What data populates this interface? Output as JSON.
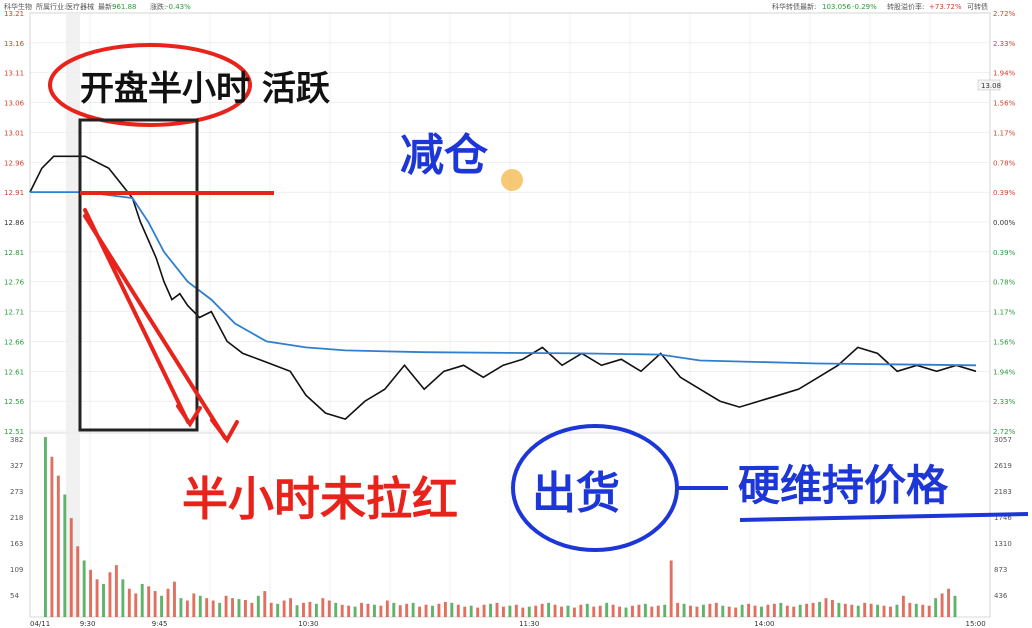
{
  "header": {
    "stock_name": "科华生物",
    "industry_label": "所属行业:",
    "industry_value": "医疗器械",
    "latest_label": "最新:",
    "latest_value": "961.88",
    "change_label": "涨跌:",
    "change_value": "-0.43%",
    "bond_label": "科华转债最新:",
    "bond_value": "103.056",
    "bond_change": "-0.29%",
    "premium_label": "转股溢价率:",
    "premium_value": "+73.72%",
    "extra_label": "可转债"
  },
  "chart_data": [
    {
      "type": "line",
      "panel": "price",
      "y_ticks_left": [
        "13.21",
        "13.16",
        "13.11",
        "13.06",
        "13.01",
        "12.96",
        "12.91",
        "12.86",
        "12.81",
        "12.76",
        "12.71",
        "12.66",
        "12.61",
        "12.56",
        "12.51"
      ],
      "y_ticks_right": [
        "2.72%",
        "2.33%",
        "1.94%",
        "1.56%",
        "1.17%",
        "0.78%",
        "0.39%",
        "0.00%",
        "0.39%",
        "0.78%",
        "1.17%",
        "1.56%",
        "1.94%",
        "2.33%",
        "2.72%"
      ],
      "ylim": [
        12.51,
        13.21
      ],
      "reference_price": 12.86,
      "current_price_label": "13.08",
      "grid": true,
      "series": [
        {
          "color": "#111111",
          "x": [
            0,
            3,
            6,
            10,
            14,
            20,
            26,
            28,
            30,
            32,
            34,
            36,
            38,
            40,
            43,
            46,
            50,
            54,
            58,
            62,
            66,
            70,
            75,
            80,
            85,
            90,
            95,
            100,
            105,
            110,
            115,
            120,
            125,
            130,
            135,
            140,
            145,
            150,
            155,
            160,
            165,
            170,
            175,
            180,
            185,
            190,
            195,
            200,
            205,
            210,
            215,
            220,
            225,
            230,
            235,
            240
          ],
          "values": [
            12.91,
            12.95,
            12.97,
            12.97,
            12.97,
            12.95,
            12.9,
            12.86,
            12.83,
            12.8,
            12.76,
            12.73,
            12.74,
            12.72,
            12.7,
            12.71,
            12.66,
            12.64,
            12.63,
            12.62,
            12.61,
            12.57,
            12.54,
            12.53,
            12.56,
            12.58,
            12.62,
            12.58,
            12.61,
            12.62,
            12.6,
            12.62,
            12.63,
            12.65,
            12.62,
            12.64,
            12.62,
            12.63,
            12.61,
            12.64,
            12.6,
            12.58,
            12.56,
            12.55,
            12.56,
            12.57,
            12.58,
            12.6,
            12.62,
            12.65,
            12.64,
            12.61,
            12.62,
            12.61,
            12.62,
            12.61
          ]
        },
        {
          "color": "#2f7fd0",
          "x": [
            0,
            14,
            26,
            30,
            34,
            40,
            46,
            52,
            60,
            70,
            80,
            100,
            140,
            160,
            170,
            200,
            240
          ],
          "values": [
            12.91,
            12.91,
            12.9,
            12.86,
            12.81,
            12.76,
            12.73,
            12.69,
            12.66,
            12.65,
            12.645,
            12.642,
            12.64,
            12.638,
            12.628,
            12.623,
            12.62
          ]
        }
      ]
    },
    {
      "type": "bar",
      "panel": "volume",
      "y_ticks_left": [
        "382",
        "327",
        "273",
        "218",
        "163",
        "109",
        "54"
      ],
      "y_ticks_right": [
        "3057",
        "2619",
        "2183",
        "1746",
        "1310",
        "873",
        "436"
      ],
      "x_ticks": [
        "04/11",
        "9:30",
        "9:45",
        "10:30",
        "11:30",
        "14:00",
        "15:00"
      ],
      "ylim": [
        0,
        382
      ],
      "values": [
        382,
        340,
        300,
        260,
        210,
        150,
        120,
        100,
        80,
        70,
        95,
        110,
        80,
        60,
        50,
        70,
        65,
        55,
        45,
        60,
        75,
        40,
        35,
        50,
        45,
        40,
        35,
        30,
        45,
        40,
        38,
        36,
        30,
        45,
        55,
        30,
        28,
        35,
        40,
        25,
        30,
        32,
        28,
        40,
        35,
        30,
        26,
        24,
        22,
        30,
        28,
        26,
        24,
        35,
        30,
        25,
        28,
        30,
        22,
        26,
        24,
        28,
        32,
        30,
        26,
        22,
        24,
        20,
        26,
        28,
        30,
        22,
        24,
        26,
        20,
        22,
        24,
        28,
        30,
        26,
        22,
        24,
        20,
        26,
        28,
        22,
        24,
        30,
        26,
        22,
        20,
        24,
        26,
        28,
        22,
        24,
        26,
        120,
        30,
        28,
        24,
        22,
        26,
        28,
        30,
        24,
        22,
        20,
        26,
        28,
        24,
        22,
        26,
        28,
        30,
        24,
        22,
        26,
        28,
        30,
        32,
        40,
        36,
        30,
        28,
        26,
        24,
        30,
        28,
        26,
        24,
        22,
        26,
        45,
        30,
        28,
        26,
        24,
        40,
        50,
        60,
        45
      ]
    }
  ],
  "annotations": {
    "top_left": "开盘半小时 活跃",
    "center_top": "减仓",
    "bottom_left": "半小时未拉红",
    "bottom_circle": "出货",
    "bottom_right": "硬维持价格"
  },
  "colors": {
    "ink_red": "#e8231c",
    "ink_blue": "#1c36d8",
    "price_line": "#111111",
    "avg_line": "#2f7fd0",
    "grid": "#e6e6e6",
    "up_red": "#d7402c",
    "down_green": "#2a9a3a"
  }
}
